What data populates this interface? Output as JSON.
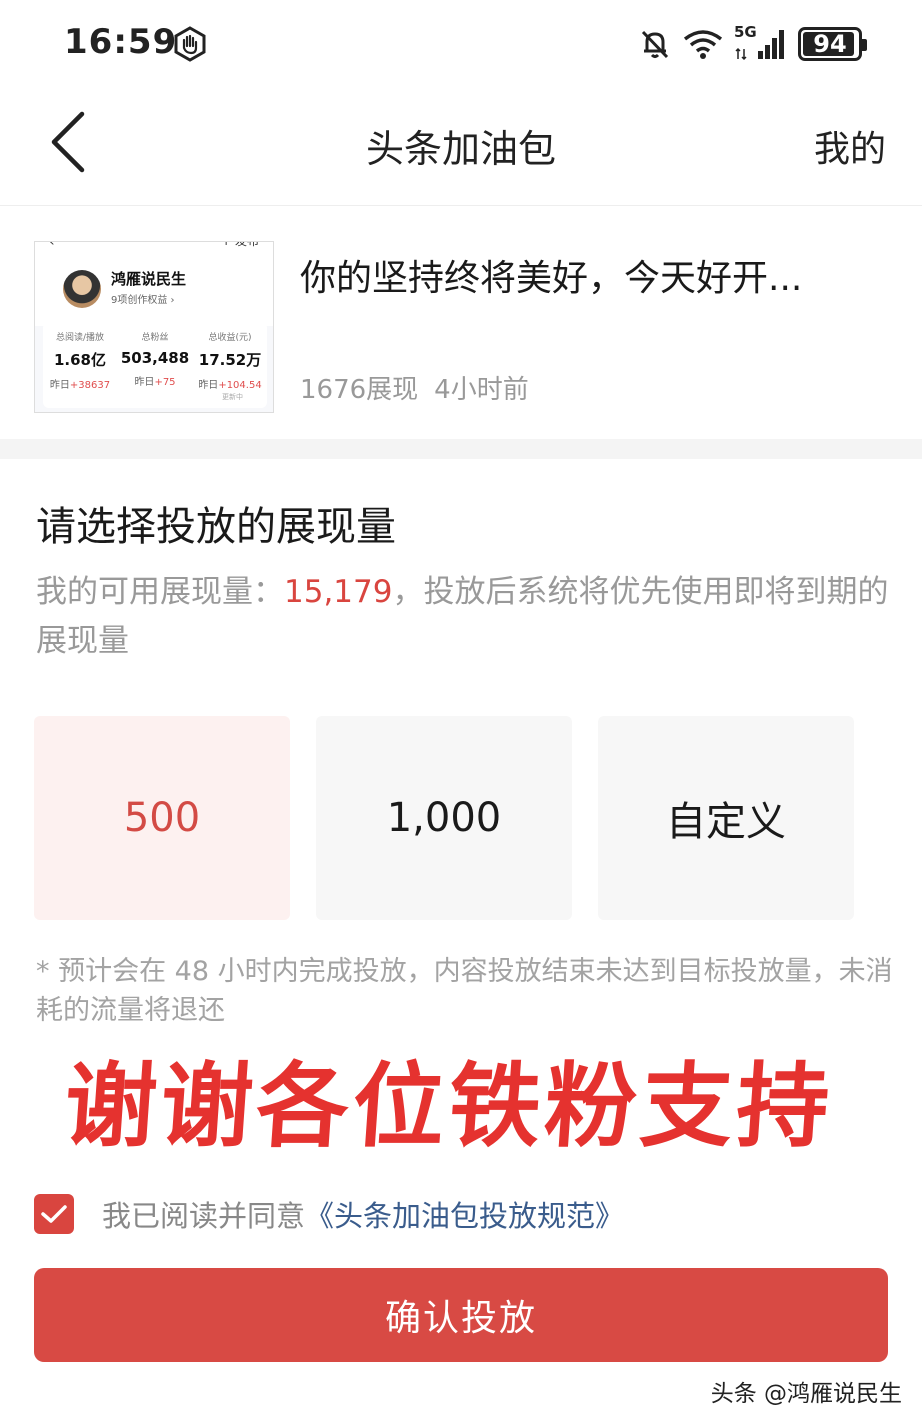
{
  "status_bar": {
    "time": "16:59",
    "network": "5G",
    "battery": "94",
    "battery_level": 0.94,
    "icons": [
      "hand-icon",
      "bell-muted-icon",
      "wifi-icon",
      "signal-icon",
      "battery-icon"
    ]
  },
  "nav": {
    "back_icon": "chevron-left-icon",
    "title": "头条加油包",
    "right_label": "我的"
  },
  "article": {
    "title": "你的坚持终将美好，今天好开...",
    "views": "1676展现",
    "time_ago": "4小时前",
    "thumbnail": {
      "name": "鸿雁说民生",
      "subtitle": "9项创作权益 ›",
      "publish": "+ 发布",
      "stats": [
        {
          "label": "总阅读/播放",
          "value": "1.68亿",
          "change_prefix": "昨日",
          "change": "+38637"
        },
        {
          "label": "总粉丝",
          "value": "503,488",
          "change_prefix": "昨日",
          "change": "+75"
        },
        {
          "label": "总收益(元)",
          "value": "17.52万",
          "change_prefix": "昨日",
          "change": "+104.54"
        }
      ],
      "tiny_note": "更新中"
    }
  },
  "selection": {
    "title": "请选择投放的展现量",
    "desc_prefix": "我的可用展现量：",
    "available": "15,179",
    "desc_suffix": "，投放后系统将优先使用即将到期的展现量",
    "options": [
      {
        "label": "500",
        "selected": true
      },
      {
        "label": "1,000",
        "selected": false
      },
      {
        "label": "自定义",
        "selected": false
      }
    ],
    "note": "* 预计会在 48 小时内完成投放，内容投放结束未达到目标投放量，未消耗的流量将退还"
  },
  "banner": "谢谢各位铁粉支持",
  "agreement": {
    "checked": true,
    "text": "我已阅读并同意",
    "link": "《头条加油包投放规范》"
  },
  "confirm_button": "确认投放",
  "watermark": "头条 @鸿雁说民生",
  "colors": {
    "accent": "#d84a44",
    "highlight": "#d9453f",
    "selected_bg": "#fdf1f0",
    "link": "#3a5c8c",
    "banner": "#e5322f"
  }
}
